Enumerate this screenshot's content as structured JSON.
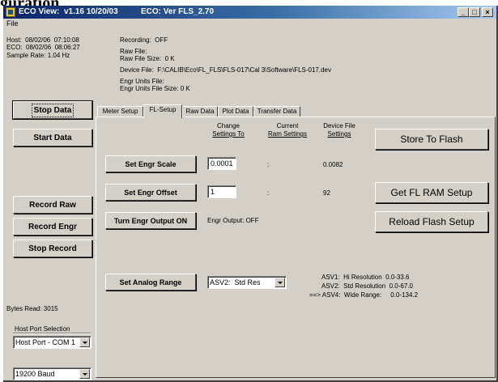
{
  "document": {
    "heading_fragment": "guration"
  },
  "window": {
    "title_app": "ECO View:  v1.16 10/20/03",
    "title_eco": "ECO: Ver FLS_2.70",
    "controls": {
      "minimize": "_",
      "maximize": "□",
      "close": "×"
    }
  },
  "menu": {
    "file": "File"
  },
  "status": {
    "host": "Host:  08/02/06  07:10:08",
    "eco": "ECO:  08/02/06  08:06:27",
    "sample_rate": "Sample Rate: 1.04 Hz",
    "recording": "Recording:  OFF",
    "raw_file": "Raw File:",
    "raw_file_size": "Raw File Size:  0 K",
    "device_file": "Device File:  F:\\CALIB\\Eco\\FL_FLS\\FLS-017\\Cal 3\\Software\\FLS-017.dev",
    "engr_units_file": "Engr Units File:",
    "engr_units_file_size": "Engr Units File Size: 0 K"
  },
  "left_panel": {
    "stop_data": "Stop Data",
    "start_data": "Start Data",
    "record_raw": "Record  Raw",
    "record_engr": "Record Engr",
    "stop_record": "Stop Record",
    "bytes_read": "Bytes Read: 3015",
    "host_port_label": "Host Port Selection",
    "host_port_value": "Host Port - COM 1",
    "baud_value": "19200 Baud"
  },
  "tabs": [
    "Meter Setup",
    "FL-Setup",
    "Raw Data",
    "Plot Data",
    "Transfer Data"
  ],
  "active_tab": "FL-Setup",
  "fl_setup": {
    "col_change": [
      "Change",
      "Settings To"
    ],
    "col_current": [
      "Current",
      "Ram Settings"
    ],
    "col_device": [
      "Device File",
      "Settings"
    ],
    "set_engr_scale": "Set Engr Scale",
    "engr_scale_value": "0.0001",
    "engr_scale_ram": ":",
    "engr_scale_device": "0.0082",
    "set_engr_offset": "Set Engr Offset",
    "engr_offset_value": "1",
    "engr_offset_ram": ":",
    "engr_offset_device": "92",
    "turn_engr_output": "Turn Engr Output ON",
    "engr_output_status": "Engr Output: OFF",
    "set_analog_range": "Set Analog Range",
    "analog_range_value": "ASV2:  Std Res",
    "range_line1": "ASV1:  Hi Resolution  0.0-33.6",
    "range_line2": "ASV2:  Std Resolution  0.0-67.0",
    "range_line3": "==> ASV4:  Wide Range:     0.0-134.2",
    "store_to_flash": "Store To Flash",
    "get_fl_ram_setup": "Get FL RAM Setup",
    "reload_flash_setup": "Reload Flash Setup"
  }
}
